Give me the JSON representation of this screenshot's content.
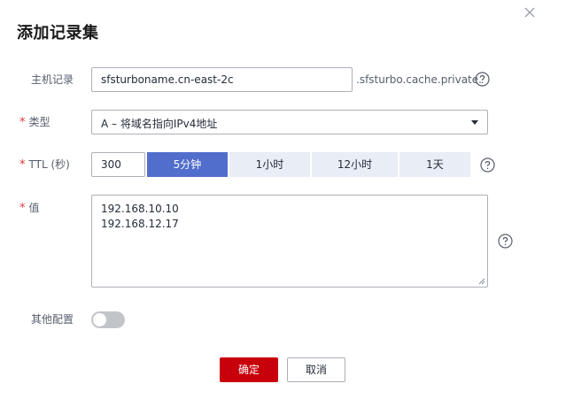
{
  "dialog": {
    "title": "添加记录集"
  },
  "form": {
    "host_record": {
      "label": "主机记录",
      "value": "sfsturboname.cn-east-2c",
      "suffix": ".sfsturbo.cache.private."
    },
    "type": {
      "label": "类型",
      "selected": "A – 将域名指向IPv4地址"
    },
    "ttl": {
      "label": "TTL (秒)",
      "value": "300",
      "options": [
        {
          "label": "5分钟",
          "active": true
        },
        {
          "label": "1小时",
          "active": false
        },
        {
          "label": "12小时",
          "active": false
        },
        {
          "label": "1天",
          "active": false
        }
      ]
    },
    "value": {
      "label": "值",
      "lines": [
        "192.168.10.10",
        "192.168.12.17"
      ]
    },
    "other_config": {
      "label": "其他配置",
      "enabled": false
    },
    "required_mark": "*"
  },
  "actions": {
    "confirm_label": "确定",
    "cancel_label": "取消"
  },
  "icons": {
    "close": "close-icon",
    "help": "help-circle-icon",
    "dropdown": "chevron-down-icon"
  },
  "colors": {
    "primary_button": "#c7000b",
    "active_segment": "#526ecc",
    "segment_bg": "#e8edf6",
    "required": "#e6353a",
    "toggle_off": "#c2c4c9"
  }
}
